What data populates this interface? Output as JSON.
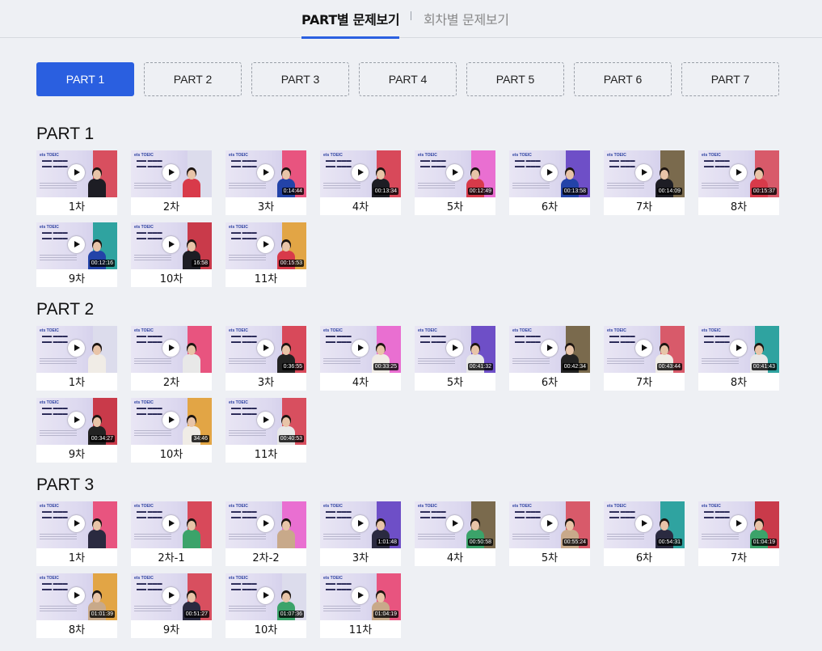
{
  "tabs": {
    "active_label": "PART별 문제보기",
    "inactive_label": "회차별 문제보기"
  },
  "part_buttons": [
    {
      "label": "PART 1",
      "active": true
    },
    {
      "label": "PART 2",
      "active": false
    },
    {
      "label": "PART 3",
      "active": false
    },
    {
      "label": "PART 4",
      "active": false
    },
    {
      "label": "PART 5",
      "active": false
    },
    {
      "label": "PART 6",
      "active": false
    },
    {
      "label": "PART 7",
      "active": false
    }
  ],
  "colors": {
    "accent": "#2a5fe0",
    "background": "#eef0f4",
    "thumb_panels": [
      "#d84f5f",
      "#dcdcec",
      "#e8547f",
      "#d8495a",
      "#e96fd1",
      "#6e4fc7",
      "#7a6a4d",
      "#d85a6a",
      "#2fa3a0",
      "#c93a4a",
      "#e2a545"
    ],
    "outfits": [
      "#1d1d24",
      "#f0ece6",
      "#2a2a40",
      "#d83a4a",
      "#e8e8e8",
      "#3ba36a",
      "#2343a8",
      "#222",
      "#c8a98a"
    ]
  },
  "thumbnail_icon": "play-icon",
  "sections": [
    {
      "title": "PART 1",
      "videos": [
        {
          "label": "1차",
          "duration": ""
        },
        {
          "label": "2차",
          "duration": ""
        },
        {
          "label": "3차",
          "duration": "0:14:44"
        },
        {
          "label": "4차",
          "duration": "00:13:34"
        },
        {
          "label": "5차",
          "duration": "00:12:49"
        },
        {
          "label": "6차",
          "duration": "00:13:58"
        },
        {
          "label": "7차",
          "duration": "00:14:09"
        },
        {
          "label": "8차",
          "duration": "00:15:37"
        },
        {
          "label": "9차",
          "duration": "00:12:16"
        },
        {
          "label": "10차",
          "duration": "16:58"
        },
        {
          "label": "11차",
          "duration": "00:15:53"
        }
      ]
    },
    {
      "title": "PART 2",
      "videos": [
        {
          "label": "1차",
          "duration": ""
        },
        {
          "label": "2차",
          "duration": ""
        },
        {
          "label": "3차",
          "duration": "0:36:55"
        },
        {
          "label": "4차",
          "duration": "00:33:25"
        },
        {
          "label": "5차",
          "duration": "00:41:32"
        },
        {
          "label": "6차",
          "duration": "00:42:34"
        },
        {
          "label": "7차",
          "duration": "00:43:44"
        },
        {
          "label": "8차",
          "duration": "00:41:43"
        },
        {
          "label": "9차",
          "duration": "00:34:27"
        },
        {
          "label": "10차",
          "duration": "34:46"
        },
        {
          "label": "11차",
          "duration": "00:40:53"
        }
      ]
    },
    {
      "title": "PART 3",
      "videos": [
        {
          "label": "1차",
          "duration": ""
        },
        {
          "label": "2차-1",
          "duration": ""
        },
        {
          "label": "2차-2",
          "duration": ""
        },
        {
          "label": "3차",
          "duration": "1:01:48"
        },
        {
          "label": "4차",
          "duration": "00:50:58"
        },
        {
          "label": "5차",
          "duration": "00:55:24"
        },
        {
          "label": "6차",
          "duration": "00:54:31"
        },
        {
          "label": "7차",
          "duration": "01:04:19"
        },
        {
          "label": "8차",
          "duration": "01:01:39"
        },
        {
          "label": "9차",
          "duration": "00:51:27"
        },
        {
          "label": "10차",
          "duration": "01:07:36"
        },
        {
          "label": "11차",
          "duration": "01:04:19"
        }
      ]
    }
  ]
}
